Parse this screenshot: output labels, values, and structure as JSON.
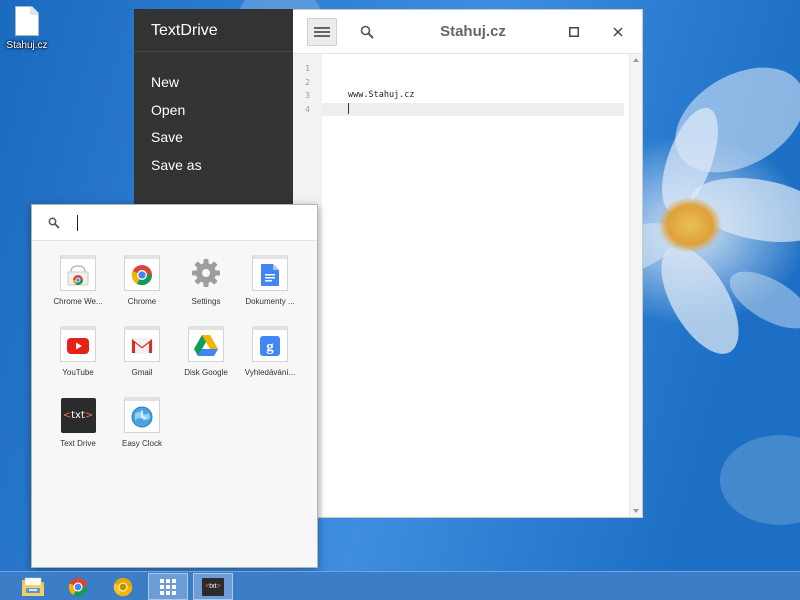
{
  "desktop": {
    "file_label": "Stahuj.cz"
  },
  "textdrive": {
    "app_title": "TextDrive",
    "menu": [
      "New",
      "Open",
      "Save",
      "Save as"
    ],
    "document_title": "Stahuj.cz",
    "line_numbers": [
      "1",
      "2",
      "3",
      "4"
    ],
    "lines": [
      "",
      "",
      "www.Stahuj.cz",
      ""
    ],
    "active_line": 4
  },
  "launcher": {
    "search_value": "",
    "apps": [
      {
        "label": "Chrome We...",
        "icon": "chrome-web-store-icon"
      },
      {
        "label": "Chrome",
        "icon": "chrome-icon"
      },
      {
        "label": "Settings",
        "icon": "gear-icon"
      },
      {
        "label": "Dokumenty ...",
        "icon": "google-docs-icon"
      },
      {
        "label": "YouTube",
        "icon": "youtube-icon"
      },
      {
        "label": "Gmail",
        "icon": "gmail-icon"
      },
      {
        "label": "Disk Google",
        "icon": "google-drive-icon"
      },
      {
        "label": "Vyhledávání...",
        "icon": "google-search-icon"
      },
      {
        "label": "Text Drive",
        "icon": "text-drive-icon"
      },
      {
        "label": "Easy Clock",
        "icon": "easy-clock-icon"
      }
    ]
  },
  "taskbar": {
    "items": [
      {
        "icon": "file-manager-icon"
      },
      {
        "icon": "chrome-icon"
      },
      {
        "icon": "chrome-canary-icon"
      },
      {
        "icon": "app-launcher-icon",
        "active": true
      },
      {
        "icon": "text-drive-icon",
        "active": true
      }
    ]
  },
  "colors": {
    "sidebar": "#333333",
    "taskbar": "#3b7dc7",
    "accent_red": "#dd4b39",
    "accent_blue": "#4285f4"
  }
}
